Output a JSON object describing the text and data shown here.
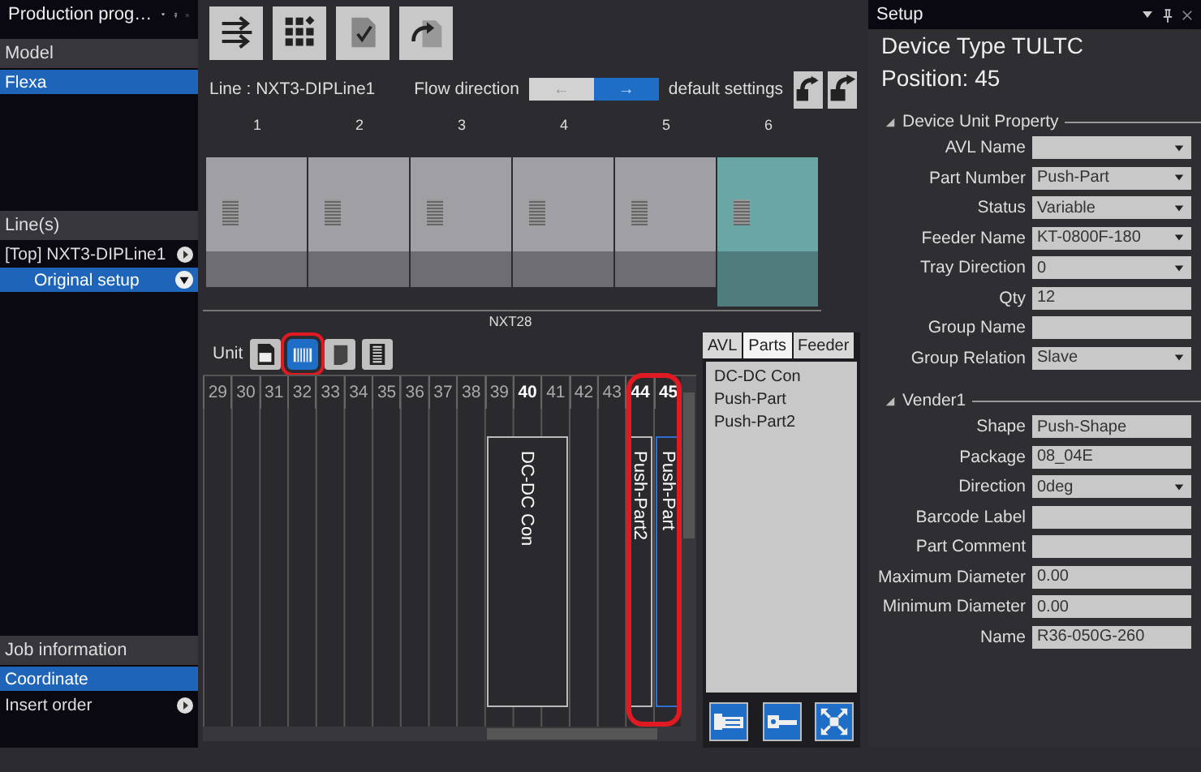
{
  "left_panel": {
    "title": "Production prog…",
    "sections": [
      {
        "header": "Model",
        "items": [
          {
            "label": "Flexa",
            "selected": true
          }
        ]
      },
      {
        "header": "Line(s)",
        "items": [
          {
            "label": "[Top] NXT3-DIPLine1",
            "selected": false,
            "kind": "arrow-right",
            "children": [
              {
                "label": "Original setup",
                "selected": true,
                "kind": "arrow-down"
              }
            ]
          }
        ]
      },
      {
        "header": "Job information",
        "items": [
          {
            "label": "Coordinate",
            "selected": true
          },
          {
            "label": "Insert order",
            "selected": false,
            "kind": "arrow-right"
          }
        ]
      }
    ]
  },
  "editor": {
    "line_label": "Line :  NXT3-DIPLine1",
    "flow_direction": {
      "label": "Flow direction",
      "options": [
        {
          "label": "←",
          "selected": false
        },
        {
          "label": "→",
          "selected": true
        }
      ]
    },
    "default_settings": "default settings",
    "modules": [
      {
        "number": "1",
        "selected": false
      },
      {
        "number": "2",
        "selected": false
      },
      {
        "number": "3",
        "selected": false
      },
      {
        "number": "4",
        "selected": false
      },
      {
        "number": "5",
        "selected": false
      },
      {
        "number": "6",
        "selected": true
      }
    ],
    "machine_name": "NXT28",
    "unit_label": "Unit",
    "unit_buttons": [
      {
        "selected": false,
        "highlighted": false
      },
      {
        "selected": true,
        "highlighted": true
      },
      {
        "selected": false,
        "highlighted": false
      },
      {
        "selected": false,
        "highlighted": false
      }
    ],
    "slots": [
      {
        "number": "29",
        "occupied": false
      },
      {
        "number": "30",
        "occupied": false
      },
      {
        "number": "31",
        "occupied": false
      },
      {
        "number": "32",
        "occupied": false
      },
      {
        "number": "33",
        "occupied": false
      },
      {
        "number": "34",
        "occupied": false
      },
      {
        "number": "35",
        "occupied": false
      },
      {
        "number": "36",
        "occupied": false
      },
      {
        "number": "37",
        "occupied": false
      },
      {
        "number": "38",
        "occupied": false
      },
      {
        "number": "39",
        "occupied": false
      },
      {
        "number": "40",
        "occupied": true,
        "part": {
          "name": "DC-DC Con",
          "kind": "triple",
          "selected": false
        }
      },
      {
        "number": "41",
        "occupied": false
      },
      {
        "number": "42",
        "occupied": false
      },
      {
        "number": "43",
        "occupied": false
      },
      {
        "number": "44",
        "occupied": true,
        "highlighted": true,
        "part": {
          "name": "Push-Part2",
          "kind": "single",
          "selected": false
        }
      },
      {
        "number": "45",
        "occupied": true,
        "highlighted": true,
        "part": {
          "name": "Push-Part",
          "kind": "single",
          "selected": true
        }
      }
    ],
    "side_tabs": [
      {
        "label": "AVL",
        "selected": false
      },
      {
        "label": "Parts",
        "selected": true
      },
      {
        "label": "Feeder",
        "selected": false
      }
    ],
    "parts_list": [
      "DC-DC Con",
      "Push-Part",
      "Push-Part2"
    ]
  },
  "setup": {
    "title": "Setup",
    "device_type": "Device Type  TULTC",
    "position": "Position: 45",
    "groups": [
      {
        "title": "Device Unit Property",
        "rows": [
          {
            "label": "AVL Name",
            "kind": "dropdown"
          },
          {
            "label": "Part Number",
            "kind": "dropdown",
            "value": "Push-Part"
          },
          {
            "label": "Status",
            "kind": "dropdown",
            "value": "Variable"
          },
          {
            "label": "Feeder Name",
            "kind": "dropdown",
            "value": "KT-0800F-180"
          },
          {
            "label": "Tray Direction",
            "kind": "dropdown",
            "value": "0"
          },
          {
            "label": "Qty",
            "kind": "text",
            "value": "12"
          },
          {
            "label": "Group Name",
            "kind": "text"
          },
          {
            "label": "Group Relation",
            "kind": "dropdown",
            "value": "Slave"
          }
        ]
      },
      {
        "title": "Vender1",
        "rows": [
          {
            "label": "Shape",
            "kind": "text",
            "value": "Push-Shape"
          },
          {
            "label": "Package",
            "kind": "text",
            "value": "08_04E"
          },
          {
            "label": "Direction",
            "kind": "dropdown",
            "value": "0deg"
          },
          {
            "label": "Barcode Label",
            "kind": "text"
          },
          {
            "label": "Part Comment",
            "kind": "text"
          },
          {
            "label": "Maximum Diameter",
            "kind": "text",
            "value": "0.00"
          },
          {
            "label": "Minimum Diameter",
            "kind": "text",
            "value": "0.00"
          },
          {
            "label": "Name",
            "kind": "text",
            "value": "R36-050G-260"
          }
        ]
      }
    ]
  }
}
